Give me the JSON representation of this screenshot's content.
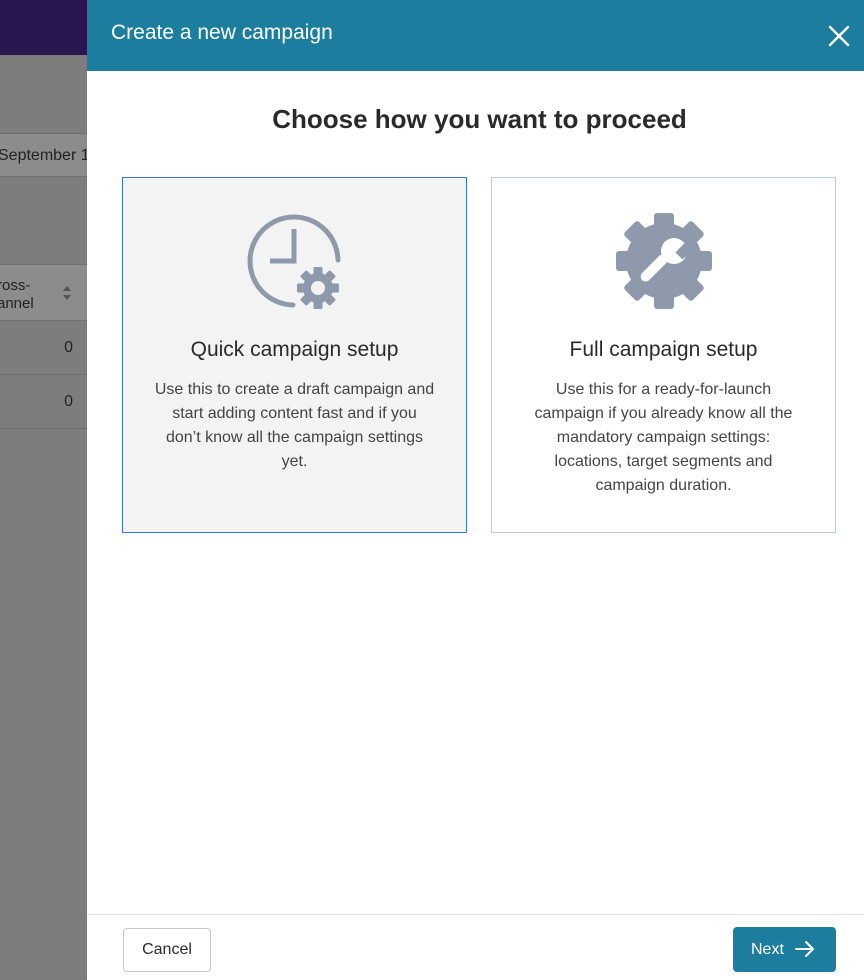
{
  "background": {
    "filter_text": "September 1",
    "column_header_line1": "ross-",
    "column_header_line2": "annel",
    "row_values": [
      "0",
      "0"
    ]
  },
  "modal": {
    "title": "Create a new campaign",
    "heading": "Choose how you want to proceed",
    "options": [
      {
        "icon": "clock-gear-icon",
        "title": "Quick campaign setup",
        "description": "Use this to create a draft campaign and start adding content fast and if you don’t know all the campaign settings yet.",
        "selected": true
      },
      {
        "icon": "wrench-gear-icon",
        "title": "Full campaign setup",
        "description": "Use this for a ready-for-launch campaign if you already know all the mandatory campaign settings: locations, target segments and campaign duration.",
        "selected": false
      }
    ],
    "cancel_label": "Cancel",
    "next_label": "Next"
  },
  "colors": {
    "header": "#1d7d9e",
    "selected_border": "#3a74d6",
    "icon": "#8e9aab"
  }
}
